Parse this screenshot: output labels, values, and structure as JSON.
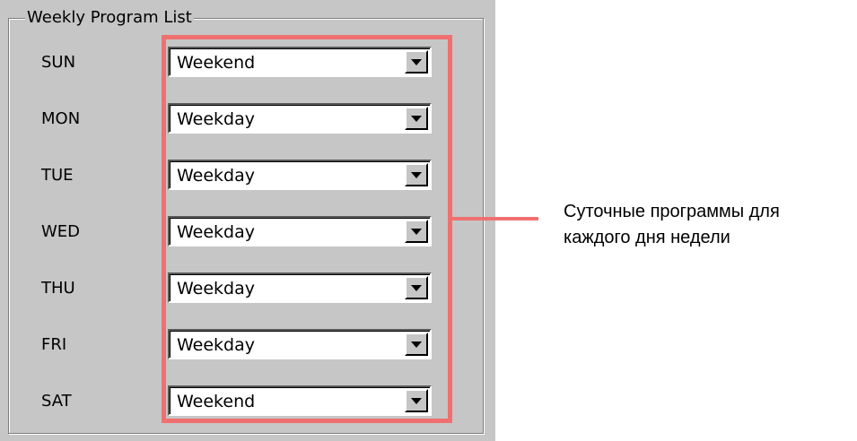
{
  "group": {
    "title": "Weekly Program List"
  },
  "days": [
    {
      "label": "SUN",
      "value": "Weekend"
    },
    {
      "label": "MON",
      "value": "Weekday"
    },
    {
      "label": "TUE",
      "value": "Weekday"
    },
    {
      "label": "WED",
      "value": "Weekday"
    },
    {
      "label": "THU",
      "value": "Weekday"
    },
    {
      "label": "FRI",
      "value": "Weekday"
    },
    {
      "label": "SAT",
      "value": "Weekend"
    }
  ],
  "annotation": {
    "line1": "Суточные программы для",
    "line2": "каждого дня недели"
  },
  "colors": {
    "highlight": "#f07070",
    "panel": "#c6c6c6"
  },
  "icons": {
    "dropdown": "chevron-down-icon"
  }
}
